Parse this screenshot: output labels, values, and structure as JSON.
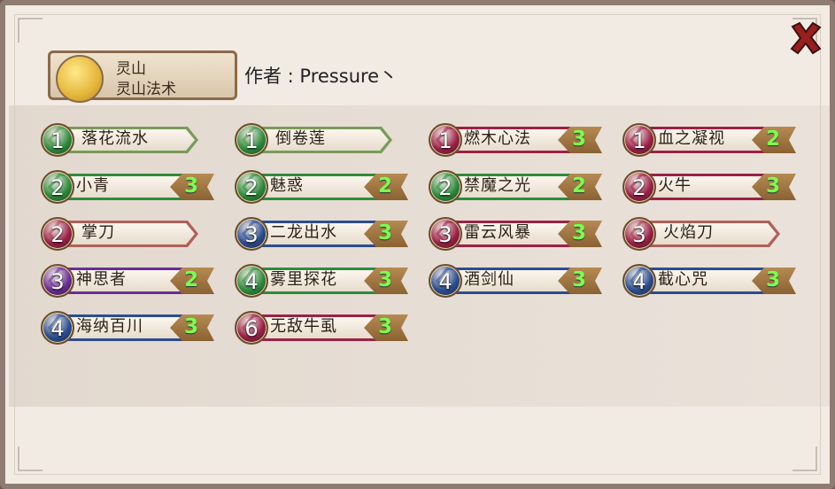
{
  "header": {
    "school_name": "灵山",
    "school_subtitle": "灵山法术",
    "author": "作者 : Pressure丶"
  },
  "close_icon": "close-icon",
  "cards": [
    {
      "level": "1",
      "name": "落花流水",
      "count": "",
      "color": "#2e8b3c"
    },
    {
      "level": "1",
      "name": "倒卷莲",
      "count": "",
      "color": "#2e8b3c"
    },
    {
      "level": "1",
      "name": "燃木心法",
      "count": "3",
      "color": "#9b2146"
    },
    {
      "level": "1",
      "name": "血之凝视",
      "count": "2",
      "color": "#9b2146"
    },
    {
      "level": "2",
      "name": "小青",
      "count": "3",
      "color": "#2e8b3c"
    },
    {
      "level": "2",
      "name": "魅惑",
      "count": "2",
      "color": "#2e8b3c"
    },
    {
      "level": "2",
      "name": "禁魔之光",
      "count": "2",
      "color": "#2e8b3c"
    },
    {
      "level": "2",
      "name": "火牛",
      "count": "3",
      "color": "#9b2146"
    },
    {
      "level": "2",
      "name": "掌刀",
      "count": "",
      "color": "#9b2146"
    },
    {
      "level": "3",
      "name": "二龙出水",
      "count": "3",
      "color": "#2b4d8f"
    },
    {
      "level": "3",
      "name": "雷云风暴",
      "count": "3",
      "color": "#9b2146"
    },
    {
      "level": "3",
      "name": "火焰刀",
      "count": "",
      "color": "#9b2146"
    },
    {
      "level": "3",
      "name": "神思者",
      "count": "2",
      "color": "#6a2d94"
    },
    {
      "level": "4",
      "name": "雾里探花",
      "count": "3",
      "color": "#2e8b3c"
    },
    {
      "level": "4",
      "name": "酒剑仙",
      "count": "3",
      "color": "#2b4d8f"
    },
    {
      "level": "4",
      "name": "截心咒",
      "count": "3",
      "color": "#2b4d8f"
    },
    {
      "level": "4",
      "name": "海纳百川",
      "count": "3",
      "color": "#2b4d8f"
    },
    {
      "level": "6",
      "name": "无敌牛虱",
      "count": "3",
      "color": "#9b2146"
    }
  ]
}
